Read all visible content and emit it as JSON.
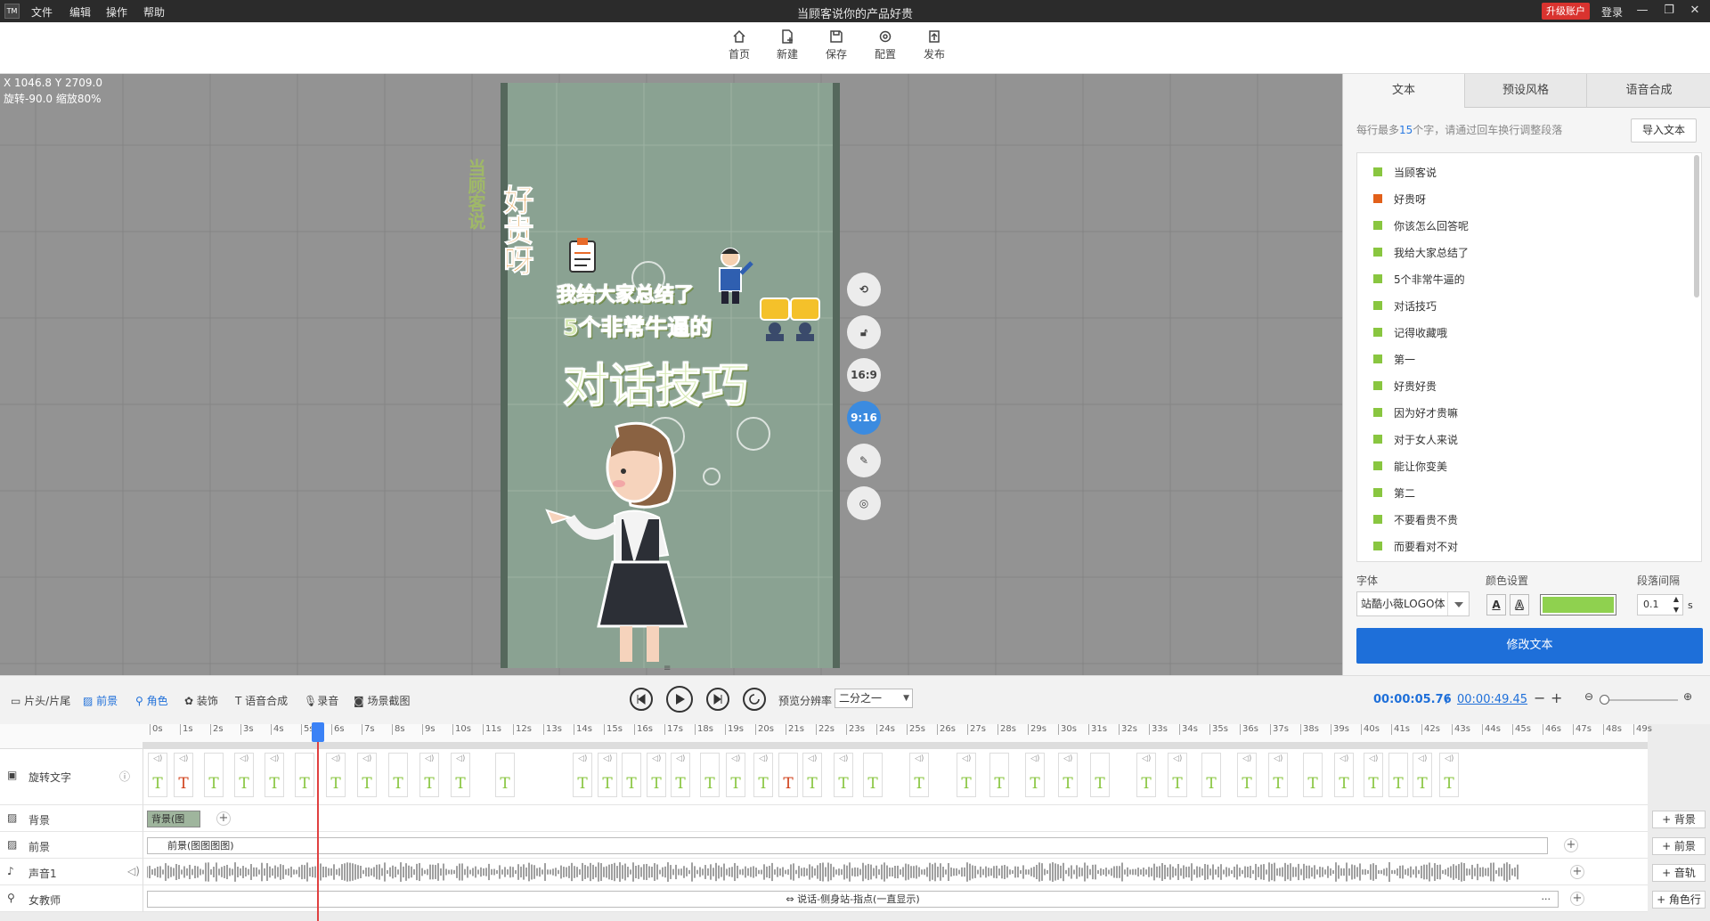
{
  "window": {
    "title": "当顾客说你的产品好贵",
    "upgrade": "升级账户",
    "login": "登录"
  },
  "menu": [
    "文件",
    "编辑",
    "操作",
    "帮助"
  ],
  "toolbar": {
    "home": "首页",
    "new": "新建",
    "save": "保存",
    "config": "配置",
    "publish": "发布"
  },
  "canvas": {
    "coords": "X 1046.8 Y 2709.0",
    "transform": "旋转-90.0 缩放80%",
    "lines": [
      "我给大家总结了",
      "5个非常牛逼的",
      "对话技巧"
    ],
    "vertical": [
      "当顾客说",
      "好贵呀"
    ],
    "ratio_169": "16:9",
    "ratio_916": "9:16"
  },
  "right_panel": {
    "tabs": [
      "文本",
      "预设风格",
      "语音合成"
    ],
    "hint_pre": "每行最多",
    "hint_num": "15",
    "hint_post": "个字，请通过回车换行调整段落",
    "import": "导入文本",
    "lines": [
      "当顾客说",
      "好贵呀",
      "你该怎么回答呢",
      "我给大家总结了",
      "5个非常牛逼的",
      "对话技巧",
      "记得收藏哦",
      "第一",
      "好贵好贵",
      "因为好才贵嘛",
      "对于女人来说",
      "能让你变美",
      "第二",
      "不要看贵不贵",
      "而要看对不对"
    ],
    "font_label": "字体",
    "font_value": "站酷小薇LOGO体",
    "color_label": "颜色设置",
    "color_value": "#8fd14f",
    "spacing_label": "段落间隔",
    "spacing_value": "0.1",
    "spacing_unit": "s",
    "modify": "修改文本"
  },
  "timeline": {
    "tools": [
      "片头/片尾",
      "前景",
      "角色",
      "装饰",
      "语音合成",
      "录音",
      "场景截图"
    ],
    "res_label": "预览分辨率",
    "res_value": "二分之一",
    "current_time": "00:00:05.76",
    "separator": "/",
    "total_time": "00:00:49.45",
    "tracks": {
      "text": "旋转文字",
      "bg": "背景",
      "fg": "前景",
      "audio": "声音1",
      "role": "女教师"
    },
    "bg_clip": "背景(图",
    "fg_clip": "前景(图图图图)",
    "role_clip": "说话-侧身站-指点(一直显示)",
    "add_bg": "+ 背景",
    "add_fg": "+ 前景",
    "add_audio": "+ 音轨",
    "add_role": "+ 角色行"
  }
}
